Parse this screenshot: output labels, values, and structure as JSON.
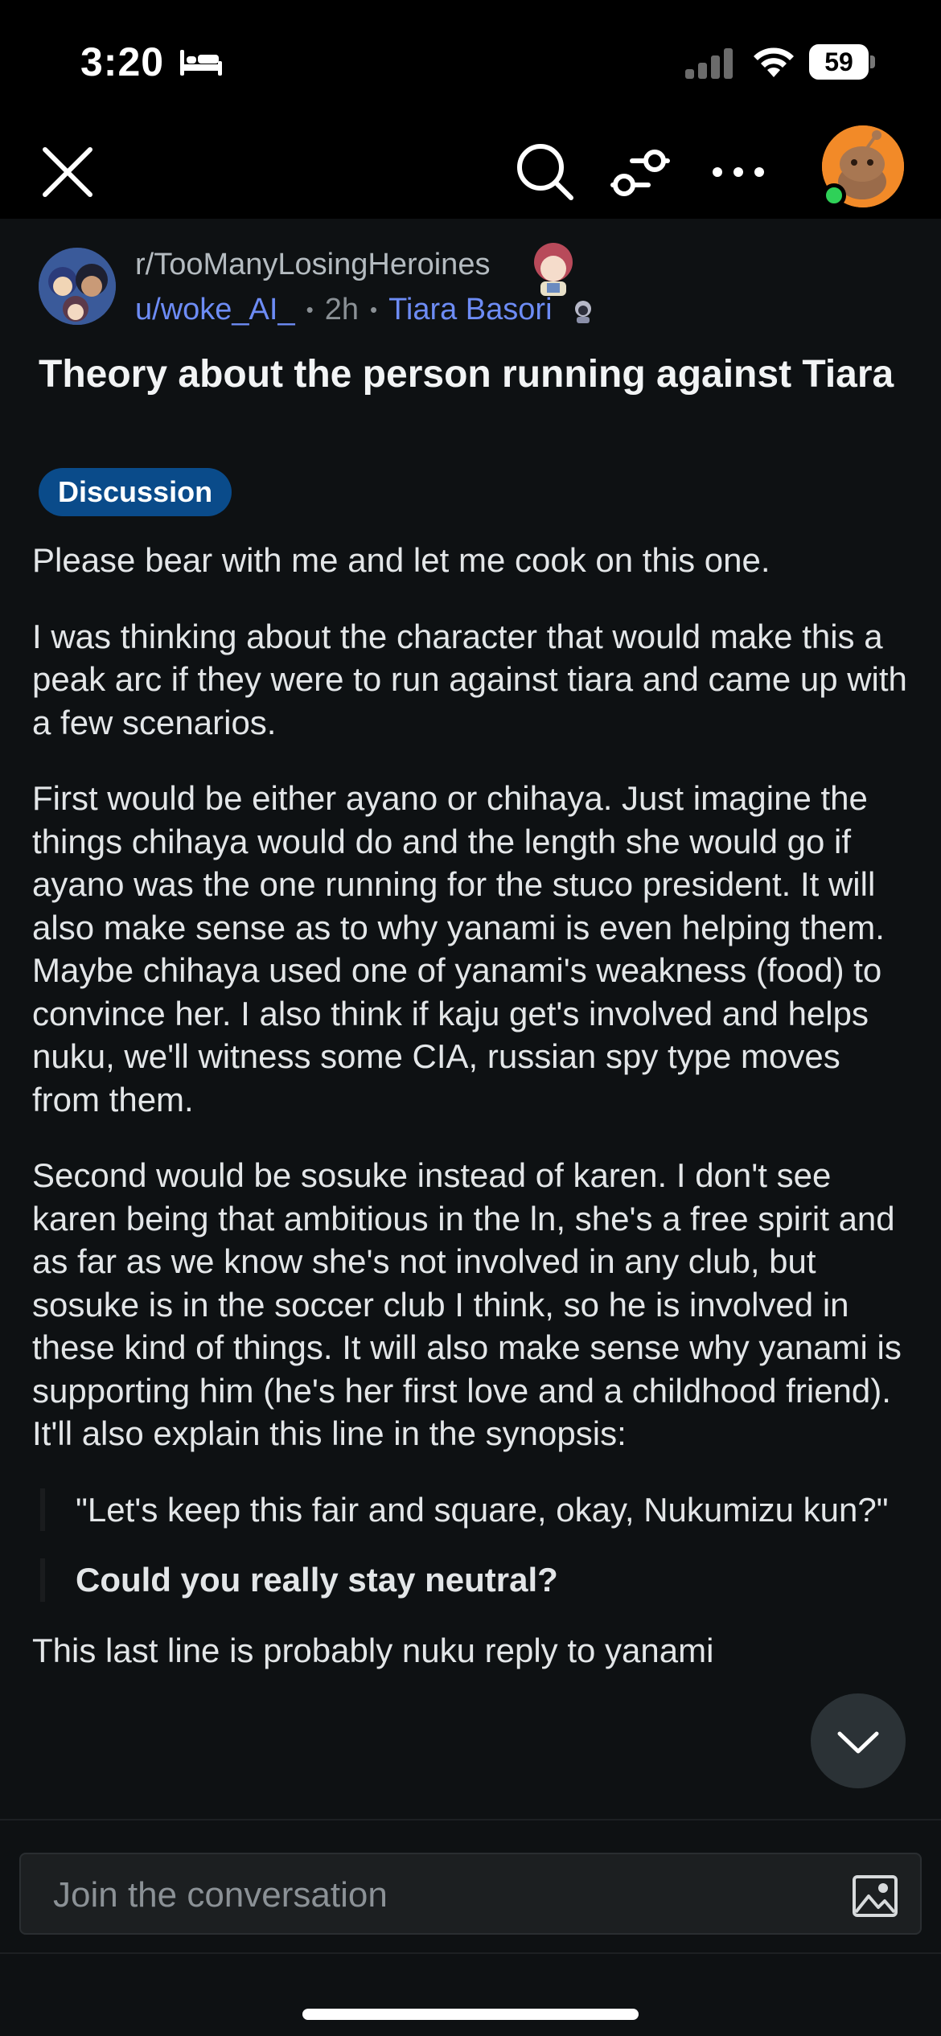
{
  "status_bar": {
    "time": "3:20",
    "battery": "59",
    "icons": [
      "bed-icon",
      "cellular-signal-icon",
      "wifi-icon",
      "battery-icon"
    ]
  },
  "toolbar": {
    "icons": [
      "close-icon",
      "search-icon",
      "filter-icon",
      "more-icon",
      "profile-avatar"
    ]
  },
  "post": {
    "subreddit": "r/TooManyLosingHeroines",
    "author": "u/woke_AI_",
    "age": "2h",
    "user_flair": "Tiara Basori",
    "title": "Theory about the person running against Tiara",
    "flair": "Discussion",
    "paragraphs": [
      "Please bear with me and let me cook on this one.",
      "I was thinking about the character that would make this a peak arc if they were to run against tiara and came up with a few scenarios.",
      "First would be either ayano or chihaya. Just imagine the things chihaya would do and the length she would go if ayano was the one running for the stuco president. It will also make sense as to why yanami is even helping them. Maybe chihaya used one of yanami's weakness (food) to convince her. I also think if kaju get's involved and helps nuku, we'll witness some CIA, russian spy type moves from them.",
      "Second would be sosuke instead of karen. I don't see karen being that ambitious in the ln, she's a free spirit and as far as we know she's not involved in any club, but sosuke is in the soccer club I think, so he is involved in these kind of things. It will also make sense why yanami is supporting him (he's her first love and a childhood friend). It'll also explain this line in the synopsis:"
    ],
    "quote_1": "\"Let's keep this fair and square, okay, Nukumizu kun?\"",
    "quote_2": "Could you really stay neutral?",
    "trailing_text": "This last line is probably nuku reply to yanami"
  },
  "composer": {
    "placeholder": "Join the conversation"
  },
  "colors": {
    "background": "#0e1113",
    "link_blue": "#6d8cf5",
    "flair_bg": "#0a4b8a",
    "avatar_orange": "#f28a28",
    "online_green": "#2fd158"
  }
}
